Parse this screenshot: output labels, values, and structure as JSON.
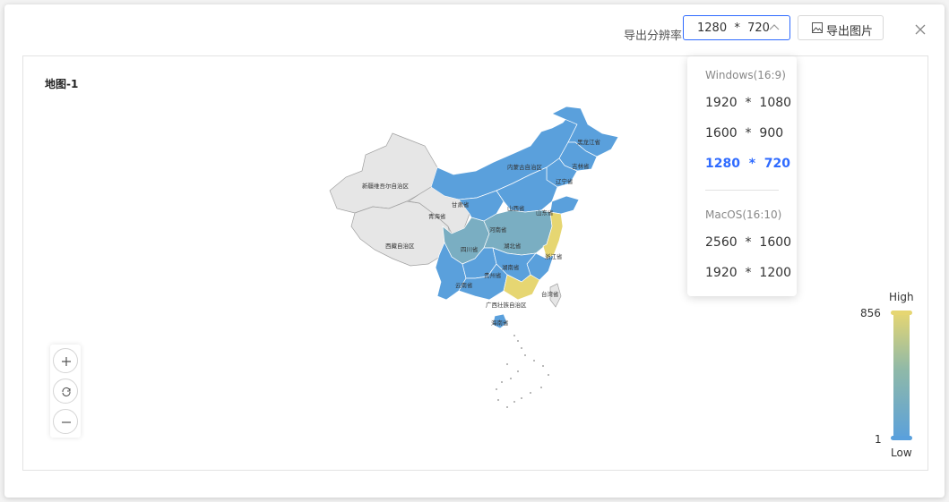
{
  "header": {
    "resolution_label": "导出分辨率",
    "resolution_value": "1280  *  720",
    "export_button_label": "导出图片"
  },
  "panel": {
    "title": "地图-1"
  },
  "dropdown": {
    "groups": [
      {
        "label": "Windows(16:9)",
        "options": [
          "1920  *  1080",
          "1600  *  900",
          "1280  *  720"
        ]
      },
      {
        "label": "MacOS(16:10)",
        "options": [
          "2560  *  1600",
          "1920  *  1200"
        ]
      }
    ],
    "selected": "1280  *  720"
  },
  "legend": {
    "high_label": "High",
    "low_label": "Low",
    "max_value": "856",
    "min_value": "1",
    "colors": {
      "high": "#e6d672",
      "mid": "#8fb9a8",
      "low": "#5aa0dc"
    }
  },
  "map": {
    "provinces": [
      "黑龙江省",
      "吉林省",
      "辽宁省",
      "内蒙古自治区",
      "新疆维吾尔自治区",
      "西藏自治区",
      "青海省",
      "甘肃省",
      "宁夏",
      "山西省",
      "山东省",
      "河南省",
      "四川省",
      "湖北省",
      "浙江省",
      "云南省",
      "贵州省",
      "湖南省",
      "江西省",
      "福建省",
      "广东省",
      "广西壮族自治区",
      "台湾省",
      "海南省",
      "上海市"
    ]
  },
  "colors": {
    "accent": "#2f6bff",
    "no_data": "#e6e6e6"
  }
}
